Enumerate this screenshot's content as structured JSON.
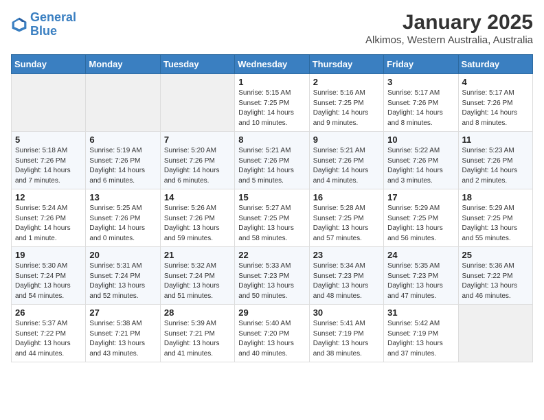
{
  "header": {
    "logo_line1": "General",
    "logo_line2": "Blue",
    "month": "January 2025",
    "location": "Alkimos, Western Australia, Australia"
  },
  "weekdays": [
    "Sunday",
    "Monday",
    "Tuesday",
    "Wednesday",
    "Thursday",
    "Friday",
    "Saturday"
  ],
  "weeks": [
    [
      {
        "day": "",
        "empty": true
      },
      {
        "day": "",
        "empty": true
      },
      {
        "day": "",
        "empty": true
      },
      {
        "day": "1",
        "sunrise": "5:15 AM",
        "sunset": "7:25 PM",
        "daylight": "14 hours and 10 minutes."
      },
      {
        "day": "2",
        "sunrise": "5:16 AM",
        "sunset": "7:25 PM",
        "daylight": "14 hours and 9 minutes."
      },
      {
        "day": "3",
        "sunrise": "5:17 AM",
        "sunset": "7:26 PM",
        "daylight": "14 hours and 8 minutes."
      },
      {
        "day": "4",
        "sunrise": "5:17 AM",
        "sunset": "7:26 PM",
        "daylight": "14 hours and 8 minutes."
      }
    ],
    [
      {
        "day": "5",
        "sunrise": "5:18 AM",
        "sunset": "7:26 PM",
        "daylight": "14 hours and 7 minutes."
      },
      {
        "day": "6",
        "sunrise": "5:19 AM",
        "sunset": "7:26 PM",
        "daylight": "14 hours and 6 minutes."
      },
      {
        "day": "7",
        "sunrise": "5:20 AM",
        "sunset": "7:26 PM",
        "daylight": "14 hours and 6 minutes."
      },
      {
        "day": "8",
        "sunrise": "5:21 AM",
        "sunset": "7:26 PM",
        "daylight": "14 hours and 5 minutes."
      },
      {
        "day": "9",
        "sunrise": "5:21 AM",
        "sunset": "7:26 PM",
        "daylight": "14 hours and 4 minutes."
      },
      {
        "day": "10",
        "sunrise": "5:22 AM",
        "sunset": "7:26 PM",
        "daylight": "14 hours and 3 minutes."
      },
      {
        "day": "11",
        "sunrise": "5:23 AM",
        "sunset": "7:26 PM",
        "daylight": "14 hours and 2 minutes."
      }
    ],
    [
      {
        "day": "12",
        "sunrise": "5:24 AM",
        "sunset": "7:26 PM",
        "daylight": "14 hours and 1 minute."
      },
      {
        "day": "13",
        "sunrise": "5:25 AM",
        "sunset": "7:26 PM",
        "daylight": "14 hours and 0 minutes."
      },
      {
        "day": "14",
        "sunrise": "5:26 AM",
        "sunset": "7:26 PM",
        "daylight": "13 hours and 59 minutes."
      },
      {
        "day": "15",
        "sunrise": "5:27 AM",
        "sunset": "7:25 PM",
        "daylight": "13 hours and 58 minutes."
      },
      {
        "day": "16",
        "sunrise": "5:28 AM",
        "sunset": "7:25 PM",
        "daylight": "13 hours and 57 minutes."
      },
      {
        "day": "17",
        "sunrise": "5:29 AM",
        "sunset": "7:25 PM",
        "daylight": "13 hours and 56 minutes."
      },
      {
        "day": "18",
        "sunrise": "5:29 AM",
        "sunset": "7:25 PM",
        "daylight": "13 hours and 55 minutes."
      }
    ],
    [
      {
        "day": "19",
        "sunrise": "5:30 AM",
        "sunset": "7:24 PM",
        "daylight": "13 hours and 54 minutes."
      },
      {
        "day": "20",
        "sunrise": "5:31 AM",
        "sunset": "7:24 PM",
        "daylight": "13 hours and 52 minutes."
      },
      {
        "day": "21",
        "sunrise": "5:32 AM",
        "sunset": "7:24 PM",
        "daylight": "13 hours and 51 minutes."
      },
      {
        "day": "22",
        "sunrise": "5:33 AM",
        "sunset": "7:23 PM",
        "daylight": "13 hours and 50 minutes."
      },
      {
        "day": "23",
        "sunrise": "5:34 AM",
        "sunset": "7:23 PM",
        "daylight": "13 hours and 48 minutes."
      },
      {
        "day": "24",
        "sunrise": "5:35 AM",
        "sunset": "7:23 PM",
        "daylight": "13 hours and 47 minutes."
      },
      {
        "day": "25",
        "sunrise": "5:36 AM",
        "sunset": "7:22 PM",
        "daylight": "13 hours and 46 minutes."
      }
    ],
    [
      {
        "day": "26",
        "sunrise": "5:37 AM",
        "sunset": "7:22 PM",
        "daylight": "13 hours and 44 minutes."
      },
      {
        "day": "27",
        "sunrise": "5:38 AM",
        "sunset": "7:21 PM",
        "daylight": "13 hours and 43 minutes."
      },
      {
        "day": "28",
        "sunrise": "5:39 AM",
        "sunset": "7:21 PM",
        "daylight": "13 hours and 41 minutes."
      },
      {
        "day": "29",
        "sunrise": "5:40 AM",
        "sunset": "7:20 PM",
        "daylight": "13 hours and 40 minutes."
      },
      {
        "day": "30",
        "sunrise": "5:41 AM",
        "sunset": "7:19 PM",
        "daylight": "13 hours and 38 minutes."
      },
      {
        "day": "31",
        "sunrise": "5:42 AM",
        "sunset": "7:19 PM",
        "daylight": "13 hours and 37 minutes."
      },
      {
        "day": "",
        "empty": true
      }
    ]
  ]
}
